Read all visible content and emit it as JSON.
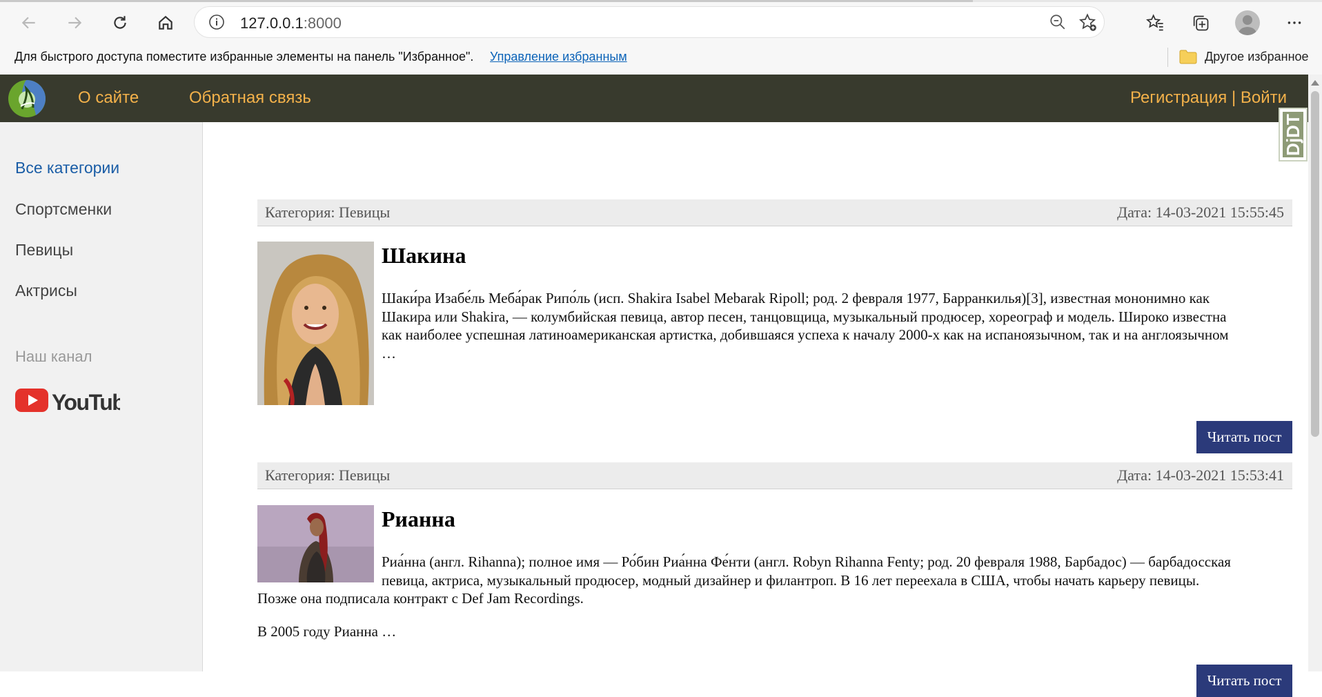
{
  "browser": {
    "url_host": "127.0.0.1",
    "url_port": ":8000",
    "favorites_message": "Для быстрого доступа поместите избранные элементы на панель \"Избранное\".",
    "favorites_manage_link": "Управление избранным",
    "other_favorites": "Другое избранное"
  },
  "header": {
    "nav": [
      "О сайте",
      "Обратная связь"
    ],
    "auth": "Регистрация | Войти",
    "debug_toolbar_label": "DjDT"
  },
  "sidebar": {
    "categories": [
      "Все категории",
      "Спортсменки",
      "Певицы",
      "Актрисы"
    ],
    "channel_label": "Наш канал",
    "youtube_text": "YouTube"
  },
  "posts": [
    {
      "category": "Категория: Певицы",
      "date": "Дата: 14-03-2021 15:55:45",
      "title": "Шакина",
      "text_lines": [
        "Шаки́ра Изабе́ль Меба́рак Рипо́ль (исп. Shakira Isabel Mebarak Ripoll; род. 2 февраля 1977, Барранкилья)[3], известная мононимно как",
        "Шакира или Shakira, — колумбийская певица, автор песен, танцовщица, музыкальный продюсер, хореограф и модель. Широко известна",
        "как наиболее успешная латиноамериканская артистка, добившаяся успеха к началу 2000-х как на испаноязычном, так и на англоязычном",
        "…"
      ],
      "button": "Читать пост"
    },
    {
      "category": "Категория: Певицы",
      "date": "Дата: 14-03-2021 15:53:41",
      "title": "Рианна",
      "text_lines": [
        "Риа́нна (англ. Rihanna); полное имя — Ро́бин Риа́нна Фе́нти (англ. Robyn Rihanna Fenty; род. 20 февраля 1988, Барбадос) — барбадосская",
        "певица, актриса, музыкальный продюсер, модный дизайнер и филантроп. В 16 лет переехала в США, чтобы начать карьеру певицы.",
        "Позже она подписала контракт с Def Jam Recordings."
      ],
      "extra_paragraph": "В 2005 году Рианна …",
      "button": "Читать пост"
    }
  ],
  "colors": {
    "header_bg": "#383a2d",
    "nav_link": "#f3b14a",
    "active_category": "#1a5da6",
    "button_bg": "#2b3a7a"
  }
}
